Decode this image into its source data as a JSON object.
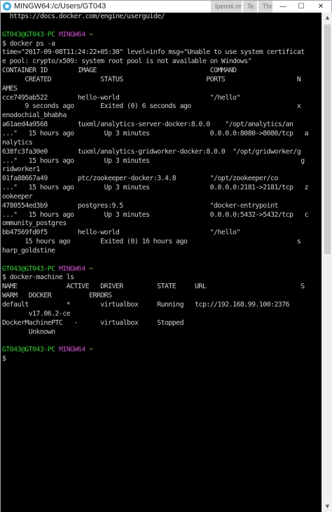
{
  "window": {
    "title": "MINGW64:/c/Users/GT043",
    "minimize_glyph": "—",
    "maximize_glyph": "☐",
    "close_glyph": "✕",
    "background_tabs": [
      "Ipensti rmhub",
      "Te",
      "Thoughtworks"
    ]
  },
  "colors": {
    "terminal_bg": "#000000",
    "text": "#cfcfcf",
    "prompt_user": "#34c934",
    "prompt_shell": "#c04dc0",
    "prompt_path": "#c8c24a"
  },
  "terminal": {
    "lines": [
      {
        "text": "  https://docs.docker.com/engine/userguide/"
      },
      {
        "text": ""
      },
      {
        "prompt": true,
        "user": "GT043@GT043-PC",
        "shell": "MINGW64",
        "path": "~"
      },
      {
        "text": "$ docker ps -a"
      },
      {
        "text": "time=\"2017-09-08T11:24:22+05:30\" level=info msg=\"Unable to use system certificat"
      },
      {
        "text": "e pool: crypto/x509: system root pool is not available on Windows\""
      },
      {
        "text": "CONTAINER ID        IMAGE                              COMMAND"
      },
      {
        "text": "      CREATED             STATUS                      PORTS                   N"
      },
      {
        "text": "AMES"
      },
      {
        "text": "cce7495ab522        hello-world                        \"/hello\""
      },
      {
        "text": "      9 seconds ago       Exited (0) 6 seconds ago                            x"
      },
      {
        "text": "enodochial_bhabha"
      },
      {
        "text": "a61aed4a9568        tuxml/analytics-server-docker:8.0.0    \"/opt/analytics/an"
      },
      {
        "text": "...\"   15 hours ago        Up 3 minutes                0.0.0.0:8080->8080/tcp   a"
      },
      {
        "text": "nalytics"
      },
      {
        "text": "638fc3fa30e0        tuxml/analytics-gridworker-docker:8.0.0  \"/opt/gridworker/g"
      },
      {
        "text": "...\"   15 hours ago        Up 3 minutes                                        g"
      },
      {
        "text": "ridworker1"
      },
      {
        "text": "01fa88667a49        ptc/zookeeper-docker:3.4.8         \"/opt/zookeeper/co"
      },
      {
        "text": "...\"   15 hours ago        Up 3 minutes                0.0.0.0:2181->2181/tcp   z"
      },
      {
        "text": "ookeeper"
      },
      {
        "text": "4780554ed3b9        postgres:9.5                       \"docker-entrypoint"
      },
      {
        "text": "...\"   15 hours ago        Up 3 minutes                0.0.0.0:5432->5432/tcp   c"
      },
      {
        "text": "ommunity_postgres"
      },
      {
        "text": "bb47569fd0f5        hello-world                        \"/hello\""
      },
      {
        "text": "      15 hours ago        Exited (0) 16 hours ago                             s"
      },
      {
        "text": "harp_goldstine"
      },
      {
        "text": ""
      },
      {
        "prompt": true,
        "user": "GT043@GT043-PC",
        "shell": "MINGW64",
        "path": "~"
      },
      {
        "text": "$ docker-machine ls"
      },
      {
        "text": "NAME             ACTIVE   DRIVER         STATE     URL                         S"
      },
      {
        "text": "WARM   DOCKER          ERRORS"
      },
      {
        "text": "default          *        virtualbox     Running   tcp://192.168.99.100:2376"
      },
      {
        "text": "       v17.06.2-ce"
      },
      {
        "text": "DockerMachinePTC   -      virtualbox     Stopped"
      },
      {
        "text": "       Unknown"
      },
      {
        "text": ""
      },
      {
        "prompt": true,
        "user": "GT043@GT043-PC",
        "shell": "MINGW64",
        "path": "~"
      },
      {
        "text": "$"
      }
    ]
  }
}
